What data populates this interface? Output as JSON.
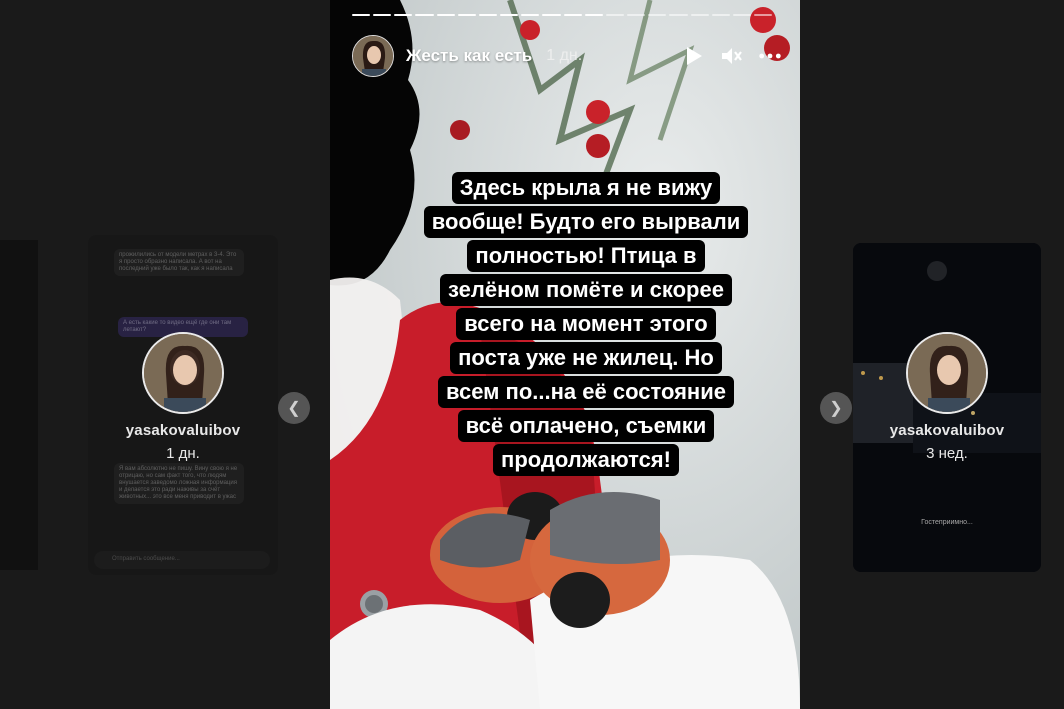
{
  "main_story": {
    "username": "Жесть как есть",
    "time": "1 дн.",
    "progress_segments": 20,
    "progress_active": 12,
    "caption_lines": [
      "Здесь крыла я не вижу",
      "вообще! Будто его вырвали",
      "полностью! Птица в",
      "зелёном помёте и скорее",
      "всего на момент этого",
      "поста уже не жилец. Но",
      "всем по...на её состояние",
      "всё оплачено, съемки",
      "продолжаются!"
    ],
    "icons": {
      "play": "play-icon",
      "mute": "mute-icon",
      "more": "more-icon"
    }
  },
  "left_preview": {
    "username": "yasakovaluibov",
    "time": "1 дн.",
    "chat_placeholder": "Отправить сообщение...",
    "chat_snippets": [
      "прожилились от модели метрах в 3-4. Это я просто образно написала. А вот на последний уже было так, как я написала",
      "А есть какие то видео ещё где они там летают?",
      "Я вам абсолютно не пишу. Вину свою я не отрицаю, но сам факт того, что людям внушается заведомо ложная информация и делается это ради наживы за счёт животных... это все меня приводит в ужас"
    ]
  },
  "right_preview": {
    "username": "yasakovaluibov",
    "time": "3 нед.",
    "bottom_text": "Гостеприимно..."
  },
  "colors": {
    "background": "#1a1a1a",
    "caption_bg": "#000000",
    "text": "#ffffff"
  }
}
